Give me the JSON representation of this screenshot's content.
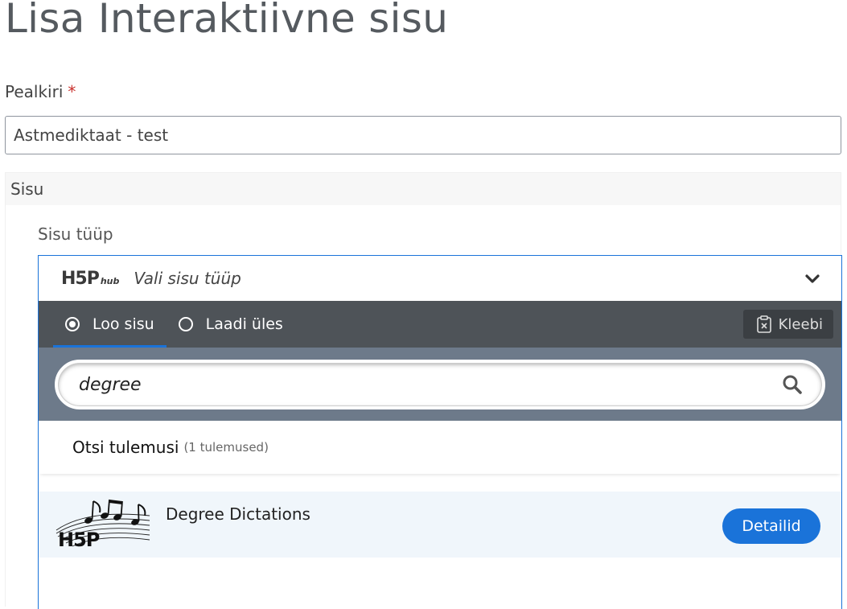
{
  "page": {
    "title": "Lisa Interaktiivne sisu"
  },
  "title_field": {
    "label": "Pealkiri",
    "required_mark": "*",
    "value": "Astmediktaat - test"
  },
  "content_section": {
    "label": "Sisu",
    "type_label": "Sisu tüüp"
  },
  "hub": {
    "logo_text": "H5P",
    "logo_suffix": "hub",
    "header_title": "Vali sisu tüüp",
    "tabs": [
      {
        "label": "Loo sisu",
        "selected": true
      },
      {
        "label": "Laadi üles",
        "selected": false
      }
    ],
    "paste_label": "Kleebi",
    "search_value": "degree",
    "results_title": "Otsi tulemusi",
    "results_count": "(1 tulemused)",
    "results": [
      {
        "title": "Degree Dictations",
        "details_label": "Detailid",
        "icon": "music-notes-h5p-icon"
      }
    ],
    "colors": {
      "accent": "#1a73d9",
      "tab_bar": "#4e5358",
      "search_area": "#6d7a8a",
      "result_row": "#f0f6fb"
    }
  }
}
